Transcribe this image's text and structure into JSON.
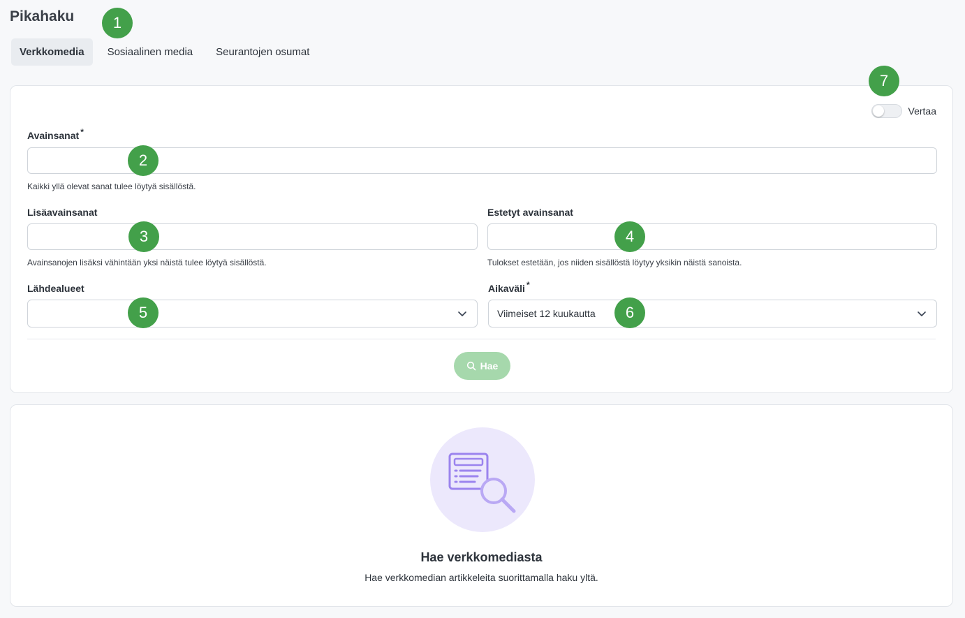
{
  "page": {
    "title": "Pikahaku"
  },
  "tabs": [
    {
      "label": "Verkkomedia",
      "active": true
    },
    {
      "label": "Sosiaalinen media",
      "active": false
    },
    {
      "label": "Seurantojen osumat",
      "active": false
    }
  ],
  "compare": {
    "label": "Vertaa",
    "enabled": false
  },
  "form": {
    "keywords": {
      "label": "Avainsanat",
      "required_mark": "*",
      "value": "",
      "help": "Kaikki yllä olevat sanat tulee löytyä sisällöstä."
    },
    "additional_keywords": {
      "label": "Lisäavainsanat",
      "value": "",
      "help": "Avainsanojen lisäksi vähintään yksi näistä tulee löytyä sisällöstä."
    },
    "blocked_keywords": {
      "label": "Estetyt avainsanat",
      "value": "",
      "help": "Tulokset estetään, jos niiden sisällöstä löytyy yksikin näistä sanoista."
    },
    "source_regions": {
      "label": "Lähdealueet",
      "value": ""
    },
    "time_range": {
      "label": "Aikaväli",
      "required_mark": "*",
      "value": "Viimeiset 12 kuukautta"
    },
    "search_button": {
      "label": "Hae"
    }
  },
  "empty_state": {
    "title": "Hae verkkomediasta",
    "text": "Hae verkkomedian artikkeleita suorittamalla haku yltä."
  },
  "badges": [
    "1",
    "2",
    "3",
    "4",
    "5",
    "6",
    "7"
  ],
  "colors": {
    "badge": "#43a04a",
    "search_button": "#a6d8ac",
    "illustration_bg": "#ece8fc",
    "illustration_icon": "#9b84ee"
  }
}
